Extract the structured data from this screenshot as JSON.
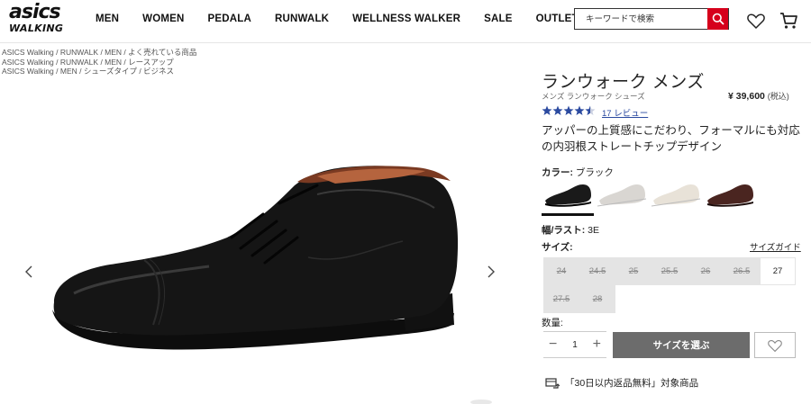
{
  "header": {
    "logo_main": "asics",
    "logo_sub": "WALKING",
    "nav": [
      "MEN",
      "WOMEN",
      "PEDALA",
      "RUNWALK",
      "WELLNESS WALKER",
      "SALE",
      "OUTLET"
    ],
    "search_placeholder": "キーワードで検索",
    "icons": [
      "search-icon",
      "heart-icon",
      "cart-icon"
    ]
  },
  "breadcrumbs": [
    [
      "ASICS Walking",
      " / RUNWALK",
      " / MEN",
      " / よく売れている商品"
    ],
    [
      "ASICS Walking",
      " / RUNWALK",
      " / MEN",
      " / レースアップ"
    ],
    [
      "ASICS Walking",
      " / MEN",
      " / シューズタイプ",
      " / ビジネス"
    ]
  ],
  "product": {
    "title": "ランウォーク メンズ",
    "subtitle": "メンズ ランウォーク シューズ",
    "price": "¥ 39,600",
    "price_tax": "(税込)",
    "rating": 4.5,
    "review_link": "17 レビュー",
    "description": "アッパーの上質感にこだわり、フォーマルにも対応の内羽根ストレートチップデザイン",
    "color_label": "カラー:",
    "color_value": "ブラック",
    "swatch_colors": [
      "#1a1a1a",
      "#d9d6d2",
      "#e8e2d8",
      "#4a2520"
    ],
    "width_label": "幅/ラスト:",
    "width_value": "3E",
    "size_label": "サイズ:",
    "size_guide": "サイズガイド",
    "sizes": [
      {
        "label": "24",
        "available": false
      },
      {
        "label": "24.5",
        "available": false
      },
      {
        "label": "25",
        "available": false
      },
      {
        "label": "25.5",
        "available": false
      },
      {
        "label": "26",
        "available": false
      },
      {
        "label": "26.5",
        "available": false
      },
      {
        "label": "27",
        "available": true
      },
      {
        "label": "27.5",
        "available": false
      },
      {
        "label": "28",
        "available": false
      }
    ],
    "qty_label": "数量:",
    "qty_value": "1",
    "qty_minus": "−",
    "qty_plus": "+",
    "select_size_button": "サイズを選ぶ",
    "return_note": "「30日以内返品無料」対象商品"
  },
  "colors": {
    "accent_red": "#d6001c",
    "review_blue": "#2b4aa0",
    "button_gray": "#6c6c6c"
  }
}
